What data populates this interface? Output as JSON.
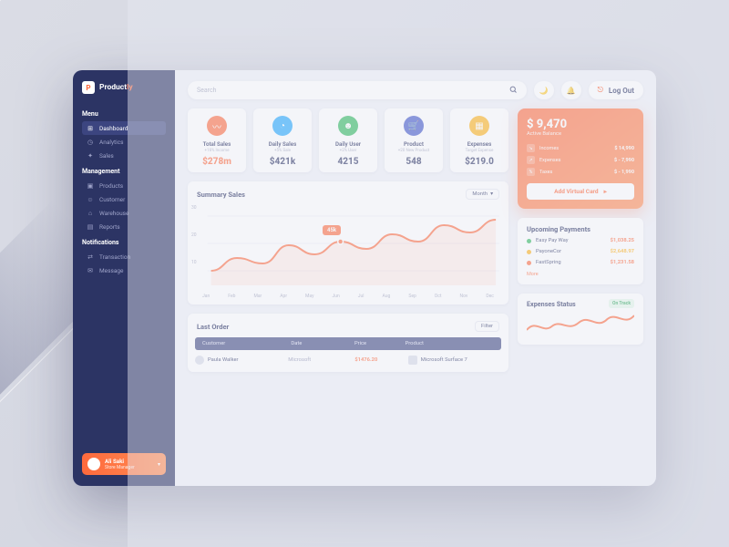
{
  "brand": {
    "name": "Product",
    "accent": "ly",
    "mark": "P"
  },
  "sidebar": {
    "sections": [
      {
        "title": "Menu",
        "items": [
          {
            "icon": "⊞",
            "label": "Dashboard",
            "active": true
          },
          {
            "icon": "◷",
            "label": "Analytics"
          },
          {
            "icon": "✦",
            "label": "Sales"
          }
        ]
      },
      {
        "title": "Management",
        "items": [
          {
            "icon": "▣",
            "label": "Products"
          },
          {
            "icon": "☺",
            "label": "Customer"
          },
          {
            "icon": "⌂",
            "label": "Warehouse"
          },
          {
            "icon": "▤",
            "label": "Reports"
          }
        ]
      },
      {
        "title": "Notifications",
        "items": [
          {
            "icon": "⇄",
            "label": "Transaction"
          },
          {
            "icon": "✉",
            "label": "Message"
          }
        ]
      }
    ],
    "user": {
      "name": "Ali Saki",
      "role": "Store Manager"
    }
  },
  "topbar": {
    "search_placeholder": "Search",
    "logout": "Log Out"
  },
  "stats": [
    {
      "icon": "〰",
      "color": "#ff6a3d",
      "label": "Total Sales",
      "sub": "+16% Income",
      "value": "$278m",
      "accent": true
    },
    {
      "icon": "◔",
      "color": "#1ea7ff",
      "label": "Daily Sales",
      "sub": "+5% Sale",
      "value": "$421k"
    },
    {
      "icon": "☻",
      "color": "#2db85c",
      "label": "Daily User",
      "sub": "+2% User",
      "value": "4215"
    },
    {
      "icon": "🛒",
      "color": "#3e55c8",
      "label": "Product",
      "sub": "+20 New Product",
      "value": "548"
    },
    {
      "icon": "▦",
      "color": "#ffb217",
      "label": "Expenses",
      "sub": "Target Expense",
      "value": "$219.0"
    }
  ],
  "summary": {
    "title": "Summary Sales",
    "range_label": "Month",
    "tooltip": "45k"
  },
  "chart_data": {
    "type": "line",
    "title": "Summary Sales",
    "xlabel": "",
    "ylabel": "",
    "ylim": [
      0,
      40
    ],
    "y_ticks": [
      10,
      20,
      30
    ],
    "categories": [
      "Jan",
      "Feb",
      "Mar",
      "Apr",
      "May",
      "Jun",
      "Jul",
      "Aug",
      "Sep",
      "Oct",
      "Nov",
      "Dec"
    ],
    "values": [
      8,
      15,
      12,
      22,
      17,
      24,
      20,
      28,
      24,
      33,
      29,
      36
    ],
    "highlight": {
      "category": "Jun",
      "value": 24,
      "label": "45k"
    }
  },
  "last_order": {
    "title": "Last Order",
    "filter_label": "Filter",
    "columns": [
      "Customer",
      "Date",
      "Price",
      "Product"
    ],
    "rows": [
      {
        "customer": "Paula Walker",
        "date": "Microsoft",
        "price": "$1476.20",
        "product": "Microsoft Surface 7"
      }
    ]
  },
  "balance": {
    "amount": "$ 9,470",
    "subtitle": "Active Balance",
    "rows": [
      {
        "icon": "↘",
        "label": "Incomes",
        "value": "$ 14,990"
      },
      {
        "icon": "↗",
        "label": "Expenses",
        "value": "$ - 7,990"
      },
      {
        "icon": "%",
        "label": "Taxes",
        "value": "$ - 1,990"
      }
    ],
    "cta": "Add Virtual Card"
  },
  "upcoming": {
    "title": "Upcoming Payments",
    "rows": [
      {
        "color": "#2db85c",
        "name": "Easy Pay Way",
        "value": "$1,038.25"
      },
      {
        "color": "#ffb217",
        "name": "PayoneCor",
        "value": "$2,648.97"
      },
      {
        "color": "#ff6a3d",
        "name": "FastSpring",
        "value": "$1,231.58"
      }
    ],
    "more": "More"
  },
  "expenses_status": {
    "title": "Expenses Status",
    "badge": "On Track"
  }
}
